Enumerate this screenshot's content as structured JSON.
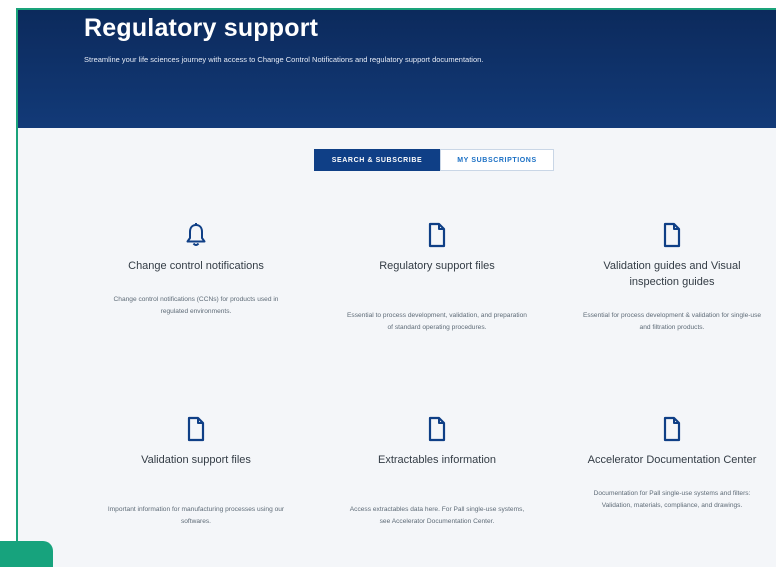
{
  "hero": {
    "title": "Regulatory support",
    "subtitle": "Streamline your life sciences journey with access to Change Control Notifications and regulatory support documentation."
  },
  "tabs": [
    {
      "label": "SEARCH & SUBSCRIBE",
      "active": true
    },
    {
      "label": "MY SUBSCRIPTIONS",
      "active": false
    }
  ],
  "cards": [
    {
      "icon": "bell-icon",
      "title": "Change control notifications",
      "description": "Change control notifications (CCNs) for products used in regulated environments."
    },
    {
      "icon": "document-icon",
      "title": "Regulatory support files",
      "description": "Essential to process development, validation, and preparation of standard operating procedures."
    },
    {
      "icon": "document-icon",
      "title": "Validation guides and Visual inspection guides",
      "description": "Essential for process development & validation for single-use and filtration products."
    },
    {
      "icon": "document-icon",
      "title": "Validation support files",
      "description": "Important information for manufacturing processes using our softwares."
    },
    {
      "icon": "document-icon",
      "title": "Extractables information",
      "description": "Access extractables data here. For Pall single-use systems, see Accelerator Documentation Center."
    },
    {
      "icon": "document-icon",
      "title": "Accelerator Documentation Center",
      "description": "Documentation for Pall single-use systems and filters: Validation, materials, compliance, and drawings."
    }
  ],
  "colors": {
    "hero_bg": "#0c2a5c",
    "tab_active_bg": "#0f3f86",
    "tab_inactive_text": "#1a6fc4",
    "icon": "#0f3f86",
    "accent_green": "#17a37d"
  }
}
